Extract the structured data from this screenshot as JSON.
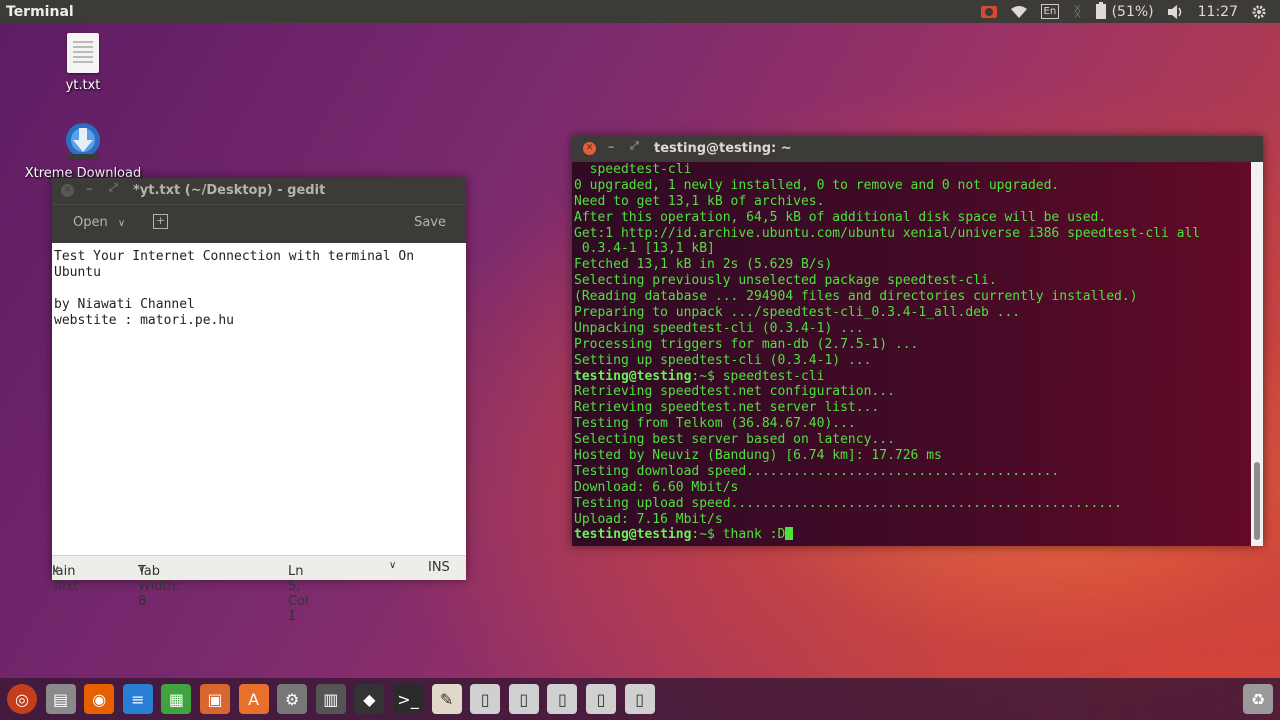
{
  "top_panel": {
    "app_title": "Terminal",
    "keyboard_layout": "En",
    "battery_text": "(51%)",
    "time": "11:27",
    "icons": [
      "record-icon",
      "wifi-icon",
      "keyboard-icon",
      "bluetooth-icon",
      "battery-icon",
      "volume-icon",
      "gear-icon"
    ]
  },
  "desktop": {
    "icons": [
      {
        "label": "yt.txt",
        "icon": "text-file-icon"
      },
      {
        "label": "Xtreme Download",
        "icon": "download-manager-icon"
      }
    ]
  },
  "gedit": {
    "title": "*yt.txt (~/Desktop) - gedit",
    "open_label": "Open",
    "save_label": "Save",
    "content": "Test Your Internet Connection with terminal On\nUbuntu\n\nby Niawati Channel\nwebstite : matori.pe.hu",
    "status": {
      "language": "lain Text",
      "tab_width": "Tab Width: 8",
      "position": "Ln 5, Col 1",
      "mode": "INS"
    }
  },
  "terminal": {
    "title": "testing@testing: ~",
    "lines": [
      {
        "text": "  speedtest-cli"
      },
      {
        "text": "0 upgraded, 1 newly installed, 0 to remove and 0 not upgraded."
      },
      {
        "text": "Need to get 13,1 kB of archives."
      },
      {
        "text": "After this operation, 64,5 kB of additional disk space will be used."
      },
      {
        "text": "Get:1 http://id.archive.ubuntu.com/ubuntu xenial/universe i386 speedtest-cli all"
      },
      {
        "text": " 0.3.4-1 [13,1 kB]"
      },
      {
        "text": "Fetched 13,1 kB in 2s (5.629 B/s)"
      },
      {
        "text": "Selecting previously unselected package speedtest-cli."
      },
      {
        "text": "(Reading database ... 294904 files and directories currently installed.)"
      },
      {
        "text": "Preparing to unpack .../speedtest-cli_0.3.4-1_all.deb ..."
      },
      {
        "text": "Unpacking speedtest-cli (0.3.4-1) ..."
      },
      {
        "text": "Processing triggers for man-db (2.7.5-1) ..."
      },
      {
        "text": "Setting up speedtest-cli (0.3.4-1) ..."
      },
      {
        "prompt": "testing@testing",
        "path": ":~$ ",
        "cmd": "speedtest-cli"
      },
      {
        "text": "Retrieving speedtest.net configuration..."
      },
      {
        "text": "Retrieving speedtest.net server list..."
      },
      {
        "text": "Testing from Telkom (36.84.67.40)..."
      },
      {
        "text": "Selecting best server based on latency..."
      },
      {
        "text": "Hosted by Neuviz (Bandung) [6.74 km]: 17.726 ms"
      },
      {
        "text": "Testing download speed........................................"
      },
      {
        "text": "Download: 6.60 Mbit/s"
      },
      {
        "text": "Testing upload speed.................................................."
      },
      {
        "text": "Upload: 7.16 Mbit/s"
      },
      {
        "prompt": "testing@testing",
        "path": ":~$ ",
        "cmd": "thank :D",
        "cursor": true
      }
    ]
  },
  "launcher": {
    "items": [
      "ubuntu-dash-icon",
      "files-icon",
      "firefox-icon",
      "libreoffice-writer-icon",
      "libreoffice-calc-icon",
      "libreoffice-impress-icon",
      "software-center-icon",
      "system-settings-icon",
      "video-editor-icon",
      "inkscape-icon",
      "terminal-icon",
      "text-editor-icon",
      "drive-icon",
      "drive-icon",
      "drive-icon",
      "drive-icon",
      "drive-icon",
      "trash-icon"
    ]
  }
}
